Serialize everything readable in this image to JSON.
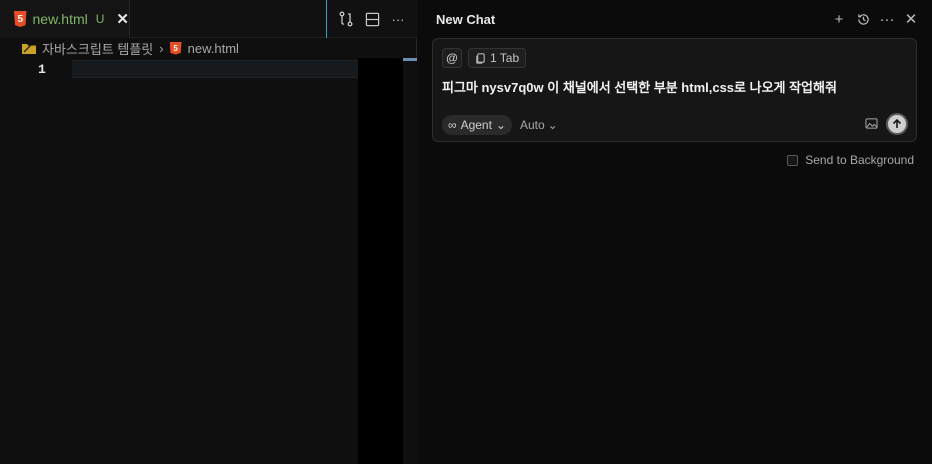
{
  "editor": {
    "tab": {
      "label": "new.html",
      "status": "U",
      "icon": "html5-icon"
    },
    "breadcrumb": {
      "folder": "자바스크립트 템플릿",
      "file": "new.html"
    },
    "lines": [
      "1"
    ]
  },
  "chat": {
    "title": "New Chat",
    "chips": {
      "at": "@",
      "tab_label": "1 Tab"
    },
    "prompt": "피그마 nysv7q0w 이 채널에서 선택한 부분 html,css로 나오게 작업해줘",
    "mode_label": "Agent",
    "model_label": "Auto",
    "send_to_background": "Send to Background"
  },
  "colors": {
    "accent": "#3aa0c8",
    "html5": "#e44d26",
    "untracked": "#7fb86a"
  }
}
